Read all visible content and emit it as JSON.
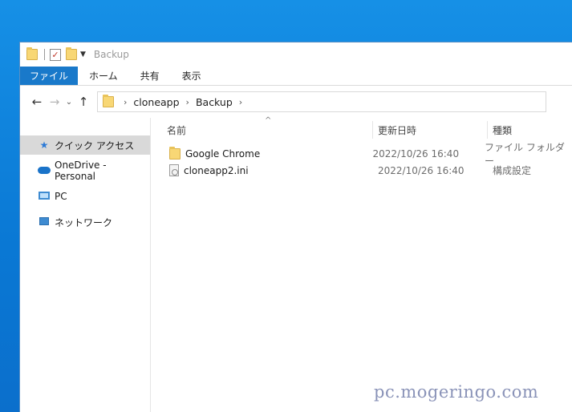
{
  "titlebar": {
    "title": "Backup"
  },
  "ribbon": {
    "tabs": [
      "ファイル",
      "ホーム",
      "共有",
      "表示"
    ]
  },
  "address": {
    "crumbs": [
      "cloneapp",
      "Backup"
    ]
  },
  "navpane": {
    "items": [
      {
        "label": "クイック アクセス",
        "icon": "star-icon"
      },
      {
        "label": "OneDrive - Personal",
        "icon": "onedrive-icon"
      },
      {
        "label": "PC",
        "icon": "pc-icon"
      },
      {
        "label": "ネットワーク",
        "icon": "network-icon"
      }
    ]
  },
  "columns": {
    "name": "名前",
    "date": "更新日時",
    "type": "種類"
  },
  "files": [
    {
      "name": "Google Chrome",
      "date": "2022/10/26 16:40",
      "type": "ファイル フォルダー",
      "icon": "folder-icon"
    },
    {
      "name": "cloneapp2.ini",
      "date": "2022/10/26 16:40",
      "type": "構成設定",
      "icon": "ini-file-icon"
    }
  ],
  "watermark": "pc.mogeringo.com"
}
